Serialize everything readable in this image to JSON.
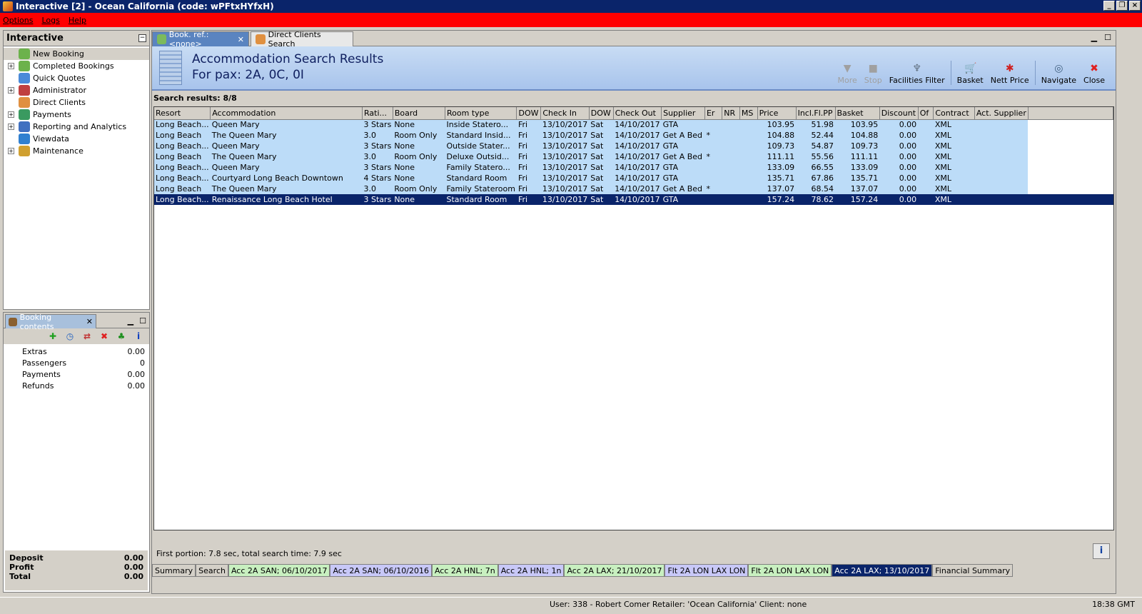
{
  "window": {
    "title": "Interactive [2] - Ocean California (code: wPFtxHYfxH)"
  },
  "menu": [
    "Options",
    "Logs",
    "Help"
  ],
  "left_panel": {
    "title": "Interactive",
    "items": [
      {
        "label": "New Booking",
        "icon": "palm-tree-icon",
        "expandable": false,
        "selected": true
      },
      {
        "label": "Completed Bookings",
        "icon": "palm-tree-icon",
        "expandable": true
      },
      {
        "label": "Quick Quotes",
        "icon": "clock-icon",
        "expandable": false
      },
      {
        "label": "Administrator",
        "icon": "admin-icon",
        "expandable": true
      },
      {
        "label": "Direct Clients",
        "icon": "clients-icon",
        "expandable": false
      },
      {
        "label": "Payments",
        "icon": "payments-icon",
        "expandable": true
      },
      {
        "label": "Reporting and Analytics",
        "icon": "chart-icon",
        "expandable": true
      },
      {
        "label": "Viewdata",
        "icon": "globe-icon",
        "expandable": false
      },
      {
        "label": "Maintenance",
        "icon": "maintenance-icon",
        "expandable": true
      }
    ]
  },
  "booking_contents": {
    "tab_label": "Booking contents",
    "rows": [
      {
        "label": "Extras",
        "value": "0.00"
      },
      {
        "label": "Passengers",
        "value": "0"
      },
      {
        "label": "Payments",
        "value": "0.00"
      },
      {
        "label": "Refunds",
        "value": "0.00"
      }
    ],
    "totals": [
      {
        "label": "Deposit",
        "value": "0.00"
      },
      {
        "label": "Profit",
        "value": "0.00"
      },
      {
        "label": "Total",
        "value": "0.00"
      }
    ]
  },
  "tabs": [
    {
      "label": "Book. ref.: <none>",
      "active": true
    },
    {
      "label": "Direct Clients Search",
      "active": false
    }
  ],
  "header": {
    "title": "Accommodation Search Results",
    "subtitle": "For pax: 2A, 0C, 0I",
    "tools": [
      {
        "label": "More",
        "icon": "triangle-down-icon",
        "enabled": false
      },
      {
        "label": "Stop",
        "icon": "stop-icon",
        "enabled": false
      },
      {
        "label": "Facilities Filter",
        "icon": "filter-icon",
        "enabled": true
      },
      {
        "label": "Basket",
        "icon": "basket-icon",
        "enabled": true
      },
      {
        "label": "Nett Price",
        "icon": "price-icon",
        "enabled": true
      },
      {
        "label": "Navigate",
        "icon": "navigate-icon",
        "enabled": true
      },
      {
        "label": "Close",
        "icon": "close-icon",
        "enabled": true
      }
    ]
  },
  "results": {
    "label": "Search results: 8/8",
    "columns": [
      "Resort",
      "Accommodation",
      "Rati...",
      "Board",
      "Room type",
      "DOW",
      "Check In",
      "DOW",
      "Check Out",
      "Supplier",
      "Er",
      "NR",
      "MS",
      "Price",
      "Incl.Fl.PP",
      "Basket",
      "Discount",
      "Of",
      "Contract",
      "Act. Supplier"
    ],
    "rows": [
      [
        "Long Beach...",
        "Queen Mary",
        "3 Stars",
        "None",
        "Inside Statero...",
        "Fri",
        "13/10/2017",
        "Sat",
        "14/10/2017",
        "GTA",
        "",
        "",
        "",
        "103.95",
        "51.98",
        "103.95",
        "0.00",
        "",
        "XML",
        ""
      ],
      [
        "Long Beach",
        "The Queen Mary",
        "3.0",
        "Room Only",
        "Standard Insid...",
        "Fri",
        "13/10/2017",
        "Sat",
        "14/10/2017",
        "Get A Bed",
        "*",
        "",
        "",
        "104.88",
        "52.44",
        "104.88",
        "0.00",
        "",
        "XML",
        ""
      ],
      [
        "Long Beach...",
        "Queen Mary",
        "3 Stars",
        "None",
        "Outside Stater...",
        "Fri",
        "13/10/2017",
        "Sat",
        "14/10/2017",
        "GTA",
        "",
        "",
        "",
        "109.73",
        "54.87",
        "109.73",
        "0.00",
        "",
        "XML",
        ""
      ],
      [
        "Long Beach",
        "The Queen Mary",
        "3.0",
        "Room Only",
        "Deluxe Outsid...",
        "Fri",
        "13/10/2017",
        "Sat",
        "14/10/2017",
        "Get A Bed",
        "*",
        "",
        "",
        "111.11",
        "55.56",
        "111.11",
        "0.00",
        "",
        "XML",
        ""
      ],
      [
        "Long Beach...",
        "Queen Mary",
        "3 Stars",
        "None",
        "Family Statero...",
        "Fri",
        "13/10/2017",
        "Sat",
        "14/10/2017",
        "GTA",
        "",
        "",
        "",
        "133.09",
        "66.55",
        "133.09",
        "0.00",
        "",
        "XML",
        ""
      ],
      [
        "Long Beach...",
        "Courtyard Long Beach Downtown",
        "4 Stars",
        "None",
        "Standard Room",
        "Fri",
        "13/10/2017",
        "Sat",
        "14/10/2017",
        "GTA",
        "",
        "",
        "",
        "135.71",
        "67.86",
        "135.71",
        "0.00",
        "",
        "XML",
        ""
      ],
      [
        "Long Beach",
        "The Queen Mary",
        "3.0",
        "Room Only",
        "Family Stateroom",
        "Fri",
        "13/10/2017",
        "Sat",
        "14/10/2017",
        "Get A Bed",
        "*",
        "",
        "",
        "137.07",
        "68.54",
        "137.07",
        "0.00",
        "",
        "XML",
        ""
      ],
      [
        "Long Beach...",
        "Renaissance Long Beach Hotel",
        "3 Stars",
        "None",
        "Standard Room",
        "Fri",
        "13/10/2017",
        "Sat",
        "14/10/2017",
        "GTA",
        "",
        "",
        "",
        "157.24",
        "78.62",
        "157.24",
        "0.00",
        "",
        "XML",
        ""
      ]
    ],
    "selected_row": 7
  },
  "timing": "First portion: 7.8 sec, total search time: 7.9 sec",
  "bottom_tabs": [
    {
      "label": "Summary",
      "color": "#d4d0c8"
    },
    {
      "label": "Search",
      "color": "#d4d0c8"
    },
    {
      "label": "Acc 2A SAN; 06/10/2017",
      "color": "#c8f0c0"
    },
    {
      "label": "Acc 2A SAN; 06/10/2016",
      "color": "#c8c8f8"
    },
    {
      "label": "Acc 2A HNL; 7n",
      "color": "#c8f0c0"
    },
    {
      "label": "Acc 2A HNL; 1n",
      "color": "#c8c8f8"
    },
    {
      "label": "Acc 2A LAX; 21/10/2017",
      "color": "#c8f0c0"
    },
    {
      "label": "Flt 2A LON LAX LON",
      "color": "#c8c8f8"
    },
    {
      "label": "Flt 2A LON LAX LON",
      "color": "#c8f0c0"
    },
    {
      "label": "Acc 2A LAX; 13/10/2017",
      "color": "#0a246a"
    },
    {
      "label": "Financial Summary",
      "color": "#d4d0c8"
    }
  ],
  "status": {
    "user": "User: 338 - Robert Comer   Retailer: 'Ocean California'   Client: none",
    "time": "18:38 GMT"
  }
}
